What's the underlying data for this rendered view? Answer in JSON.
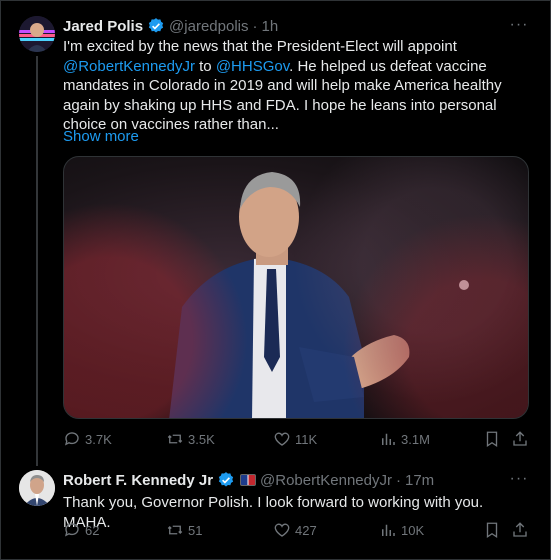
{
  "tweets": [
    {
      "author_name": "Jared Polis",
      "handle": "@jaredpolis",
      "separator": "·",
      "time": "1h",
      "text_parts": [
        "I'm excited by the news that the President-Elect will appoint ",
        "@RobertKennedyJr",
        " to ",
        "@HHSGov",
        ". He helped us defeat vaccine mandates in Colorado in 2019 and will help make America healthy again by shaking up HHS and FDA. I hope he leans into personal choice on vaccines rather than..."
      ],
      "show_more": "Show more",
      "stats": {
        "replies": "3.7K",
        "reposts": "3.5K",
        "likes": "11K",
        "views": "3.1M"
      }
    },
    {
      "author_name": "Robert F. Kennedy Jr",
      "handle": "@RobertKennedyJr",
      "separator": "·",
      "time": "17m",
      "text": "Thank you, Governor Polish. I look forward to working with you. MAHA.",
      "stats": {
        "replies": "62",
        "reposts": "51",
        "likes": "427",
        "views": "10K"
      }
    }
  ],
  "colors": {
    "background": "#000000",
    "text": "#e7e9ea",
    "muted": "#71767b",
    "link": "#1d9bf0",
    "border": "#2f3336"
  },
  "icons": [
    "verified-badge-icon",
    "more-icon",
    "reply-icon",
    "repost-icon",
    "like-icon",
    "views-icon",
    "bookmark-icon",
    "share-icon"
  ]
}
